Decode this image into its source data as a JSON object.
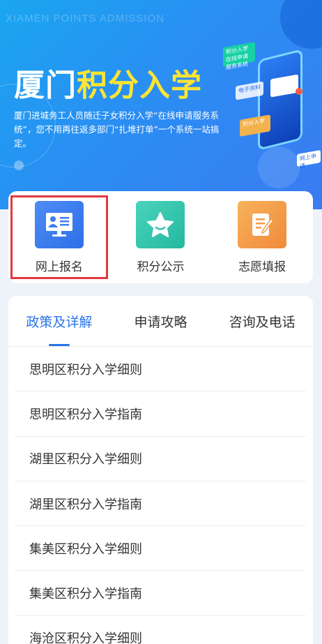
{
  "hero": {
    "tag": "XIAMEN POINTS ADMISSION",
    "title_part1": "厦门",
    "title_part2": "积分入学",
    "description": "厦门进城务工人员随迁子女积分入学“在线申请服务系统”，您不用再往返多部门“扎堆打单”一个系统一站搞定。",
    "art_labels": {
      "card1": "积分入学在线申请服务系统",
      "card2": "电子资料",
      "card3": "积分入学",
      "card4": "网上申请"
    }
  },
  "quick_actions": [
    {
      "label": "网上报名",
      "icon": "online-registration-icon",
      "color": "#3d7ef0"
    },
    {
      "label": "积分公示",
      "icon": "star-icon",
      "color": "#33c4ac"
    },
    {
      "label": "志愿填报",
      "icon": "form-edit-icon",
      "color": "#f49b48"
    }
  ],
  "tabs": [
    {
      "label": "政策及详解",
      "active": true
    },
    {
      "label": "申请攻略",
      "active": false
    },
    {
      "label": "咨询及电话",
      "active": false
    }
  ],
  "policy_list": [
    "思明区积分入学细则",
    "思明区积分入学指南",
    "湖里区积分入学细则",
    "湖里区积分入学指南",
    "集美区积分入学细则",
    "集美区积分入学指南",
    "海沧区积分入学细则"
  ],
  "colors": {
    "accent": "#2a74e8",
    "highlight": "#ffe433",
    "selection_border": "#e2393f"
  }
}
